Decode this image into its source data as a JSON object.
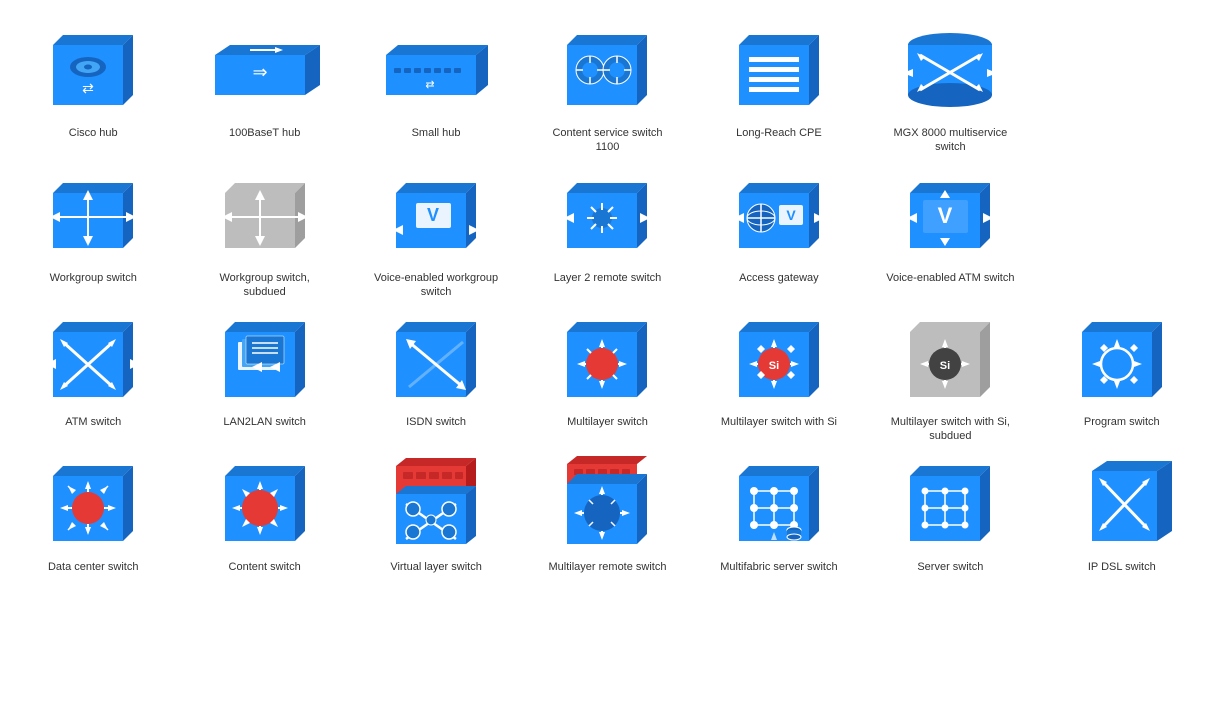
{
  "items": [
    {
      "id": "cisco-hub",
      "label": "Cisco hub",
      "type": "cisco-hub"
    },
    {
      "id": "100baset-hub",
      "label": "100BaseT hub",
      "type": "100baset-hub"
    },
    {
      "id": "small-hub",
      "label": "Small hub",
      "type": "small-hub"
    },
    {
      "id": "content-service-switch-1100",
      "label": "Content service switch 1100",
      "type": "content-service-switch-1100"
    },
    {
      "id": "long-reach-cpe",
      "label": "Long-Reach CPE",
      "type": "long-reach-cpe"
    },
    {
      "id": "mgx-8000",
      "label": "MGX 8000 multiservice switch",
      "type": "mgx-8000"
    },
    {
      "id": "placeholder1",
      "label": "",
      "type": "empty"
    },
    {
      "id": "workgroup-switch",
      "label": "Workgroup switch",
      "type": "workgroup-switch"
    },
    {
      "id": "workgroup-switch-subdued",
      "label": "Workgroup switch, subdued",
      "type": "workgroup-switch-subdued"
    },
    {
      "id": "voice-enabled-workgroup",
      "label": "Voice-enabled workgroup switch",
      "type": "voice-enabled-workgroup"
    },
    {
      "id": "layer2-remote-switch",
      "label": "Layer 2 remote switch",
      "type": "layer2-remote-switch"
    },
    {
      "id": "access-gateway",
      "label": "Access gateway",
      "type": "access-gateway"
    },
    {
      "id": "voice-enabled-atm",
      "label": "Voice-enabled ATM switch",
      "type": "voice-enabled-atm"
    },
    {
      "id": "placeholder2",
      "label": "",
      "type": "empty"
    },
    {
      "id": "atm-switch",
      "label": "ATM switch",
      "type": "atm-switch"
    },
    {
      "id": "lan2lan-switch",
      "label": "LAN2LAN switch",
      "type": "lan2lan-switch"
    },
    {
      "id": "isdn-switch",
      "label": "ISDN switch",
      "type": "isdn-switch"
    },
    {
      "id": "multilayer-switch",
      "label": "Multilayer switch",
      "type": "multilayer-switch"
    },
    {
      "id": "multilayer-switch-si",
      "label": "Multilayer switch with Si",
      "type": "multilayer-switch-si"
    },
    {
      "id": "multilayer-switch-si-subdued",
      "label": "Multilayer switch with Si, subdued",
      "type": "multilayer-switch-si-subdued"
    },
    {
      "id": "program-switch",
      "label": "Program switch",
      "type": "program-switch"
    },
    {
      "id": "data-center-switch",
      "label": "Data center switch",
      "type": "data-center-switch"
    },
    {
      "id": "content-switch",
      "label": "Content switch",
      "type": "content-switch"
    },
    {
      "id": "virtual-layer-switch",
      "label": "Virtual layer switch",
      "type": "virtual-layer-switch"
    },
    {
      "id": "multilayer-remote-switch",
      "label": "Multilayer remote switch",
      "type": "multilayer-remote-switch"
    },
    {
      "id": "multifabric-server-switch",
      "label": "Multifabric server switch",
      "type": "multifabric-server-switch"
    },
    {
      "id": "server-switch",
      "label": "Server switch",
      "type": "server-switch"
    },
    {
      "id": "ip-dsl-switch",
      "label": "IP DSL switch",
      "type": "ip-dsl-switch"
    }
  ]
}
